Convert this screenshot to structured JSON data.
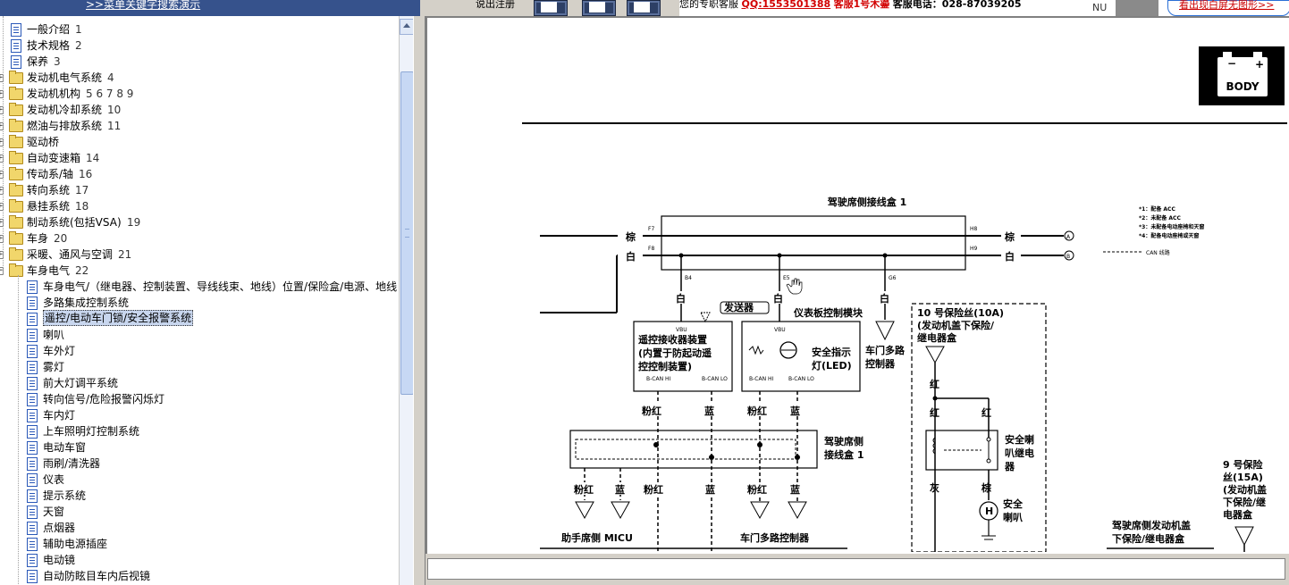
{
  "topbar": {
    "search_link": ">>菜单关键字搜索演示",
    "mid_text": "说出注册",
    "support_text": "您的专职客服",
    "qq": "QQ:1553501388",
    "support_highlight": "客服1号木鎏",
    "phone": "客服电话：028-87039205",
    "nu_text": "NU",
    "promo": "看出现白屏无图形>>"
  },
  "tree": {
    "items": [
      {
        "label": "一般介绍",
        "num": "1",
        "type": "doc"
      },
      {
        "label": "技术规格",
        "num": "2",
        "type": "doc"
      },
      {
        "label": "保养",
        "num": "3",
        "type": "doc"
      },
      {
        "label": "发动机电气系统",
        "num": "4",
        "type": "folder"
      },
      {
        "label": "发动机机构",
        "num": "5 6 7 8 9",
        "type": "folder"
      },
      {
        "label": "发动机冷却系统",
        "num": "10",
        "type": "folder"
      },
      {
        "label": "燃油与排放系统",
        "num": "11",
        "type": "folder"
      },
      {
        "label": "驱动桥",
        "num": "",
        "type": "folder"
      },
      {
        "label": "自动变速箱",
        "num": "14",
        "type": "folder"
      },
      {
        "label": "传动系/轴",
        "num": "16",
        "type": "folder"
      },
      {
        "label": "转向系统",
        "num": "17",
        "type": "folder"
      },
      {
        "label": "悬挂系统",
        "num": "18",
        "type": "folder"
      },
      {
        "label": "制动系统(包括VSA)",
        "num": "19",
        "type": "folder"
      },
      {
        "label": "车身",
        "num": "20",
        "type": "folder"
      },
      {
        "label": "采暖、通风与空调",
        "num": "21",
        "type": "folder"
      },
      {
        "label": "车身电气",
        "num": "22",
        "type": "folder-open"
      }
    ],
    "children": [
      "车身电气/（继电器、控制装置、导线线束、地线）位置/保险盒/电源、地线",
      "多路集成控制系统",
      "遥控/电动车门锁/安全报警系统",
      "喇叭",
      "车外灯",
      "雾灯",
      "前大灯调平系统",
      "转向信号/危险报警闪烁灯",
      "车内灯",
      "上车照明灯控制系统",
      "电动车窗",
      "雨刷/清洗器",
      "仪表",
      "提示系统",
      "天窗",
      "点烟器",
      "辅助电源插座",
      "电动镜",
      "自动防眩目车内后视镜"
    ],
    "selected_child": 2
  },
  "diagram": {
    "body_label": "BODY",
    "junction_box_title": "驾驶席侧接线盒 1",
    "wire_brown": "棕",
    "wire_white": "白",
    "wire_red": "红",
    "wire_blue": "蓝",
    "wire_pink_red": "粉红",
    "wire_gray": "灰",
    "pin_f7": "F7",
    "pin_f8": "F8",
    "pin_h8": "H8",
    "pin_h9": "H9",
    "pin_b4": "B4",
    "pin_e5": "E5",
    "pin_g6": "G6",
    "transmitter": "发送器",
    "dash_module": "仪表板控制模块",
    "receiver_line1": "遥控接收器装置",
    "receiver_line2": "(内置于防起动遥",
    "receiver_line3": "控控制装置)",
    "vbu": "VBU",
    "bcan_hi": "B-CAN HI",
    "bcan_lo": "B-CAN LO",
    "security_led_line1": "安全指示",
    "security_led_line2": "灯(LED)",
    "door_controller_line1": "车门多路",
    "door_controller_line2": "控制器",
    "notes": [
      "*1：配备 ACC",
      "*2：未配备 ACC",
      "*3：未配备电动座椅和天窗",
      "*4：配备电动座椅或天窗"
    ],
    "can_line_label": "CAN 线路",
    "fuse10_line1": "10 号保险丝(10A)",
    "fuse10_line2": "(发动机盖下保险/",
    "fuse10_line3": "继电器盒",
    "horn_relay_line1": "安全喇",
    "horn_relay_line2": "叭继电",
    "horn_relay_line3": "器",
    "horn_line1": "安全",
    "horn_line2": "喇叭",
    "junction_box2_line1": "驾驶席侧",
    "junction_box2_line2": "接线盒 1",
    "micu_label": "助手席侧 MICU",
    "door_mux_label": "车门多路控制器",
    "fuse9_line1": "9 号保险",
    "fuse9_line2": "丝(15A)",
    "fuse9_line3": "(发动机盖",
    "fuse9_line4": "下保险/继",
    "fuse9_line5": "电器盒",
    "under_hood_line1": "驾驶席侧发动机盖",
    "under_hood_line2": "下保险/继电器盒",
    "connector_a": "A",
    "connector_b": "B"
  }
}
